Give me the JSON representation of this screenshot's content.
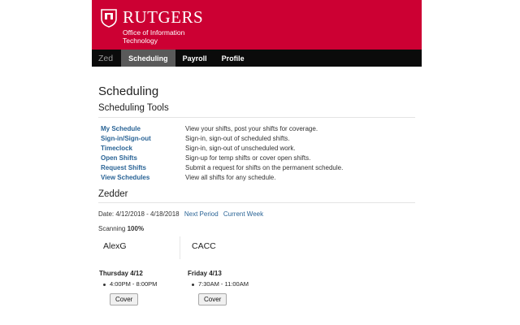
{
  "header": {
    "logo_word": "RUTGERS",
    "logo_sub": "Office of Information Technology",
    "brand_color": "#cc0033"
  },
  "nav": {
    "brand": "Zed",
    "items": [
      "Scheduling",
      "Payroll",
      "Profile"
    ],
    "active": "Scheduling"
  },
  "page": {
    "title": "Scheduling",
    "tools_title": "Scheduling Tools",
    "tools": [
      {
        "label": "My Schedule",
        "desc": "View your shifts, post your shifts for coverage."
      },
      {
        "label": "Sign-in/Sign-out",
        "desc": "Sign-in, sign-out of scheduled shifts."
      },
      {
        "label": "Timeclock",
        "desc": "Sign-in, sign-out of unscheduled work."
      },
      {
        "label": "Open Shifts",
        "desc": "Sign-up for temp shifts or cover open shifts."
      },
      {
        "label": "Request Shifts",
        "desc": "Submit a request for shifts on the permanent schedule."
      },
      {
        "label": "View Schedules",
        "desc": "View all shifts for any schedule."
      }
    ],
    "zedder_title": "Zedder",
    "date_label": "Date: 4/12/2018 - 4/18/2018",
    "next_period": "Next Period",
    "current_week": "Current Week",
    "scanning_label": "Scanning",
    "scanning_value": "100%",
    "columns": [
      {
        "name": "AlexG",
        "day": "Thursday 4/12",
        "shift": "4:00PM - 8:00PM",
        "button": "Cover"
      },
      {
        "name": "CACC",
        "day": "Friday 4/13",
        "shift": "7:30AM - 11:00AM",
        "button": "Cover"
      }
    ]
  }
}
